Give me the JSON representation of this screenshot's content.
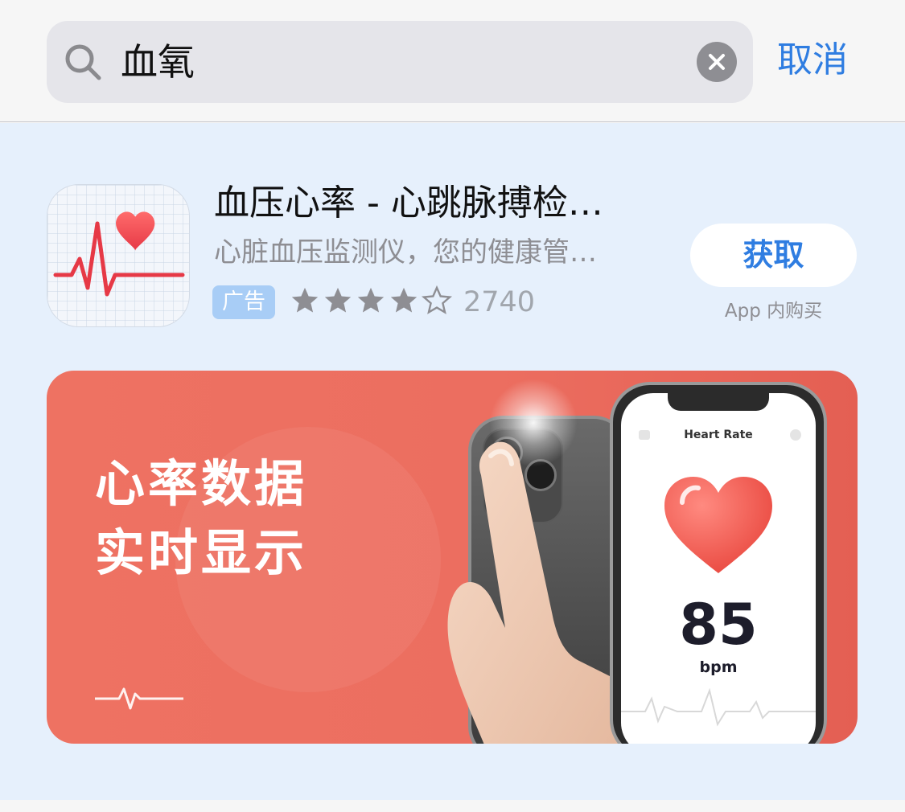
{
  "search": {
    "query": "血氧",
    "cancel_label": "取消"
  },
  "result": {
    "title": "血压心率 - 心跳脉搏检…",
    "subtitle": "心脏血压监测仪，您的健康管…",
    "ad_badge": "广告",
    "rating": 4,
    "rating_max": 5,
    "rating_count": "2740",
    "get_label": "获取",
    "in_app_note": "App 内购买"
  },
  "banner": {
    "line1": "心率数据",
    "line2": "实时显示",
    "screen_title": "Heart Rate",
    "bpm_value": "85",
    "bpm_unit": "bpm"
  },
  "colors": {
    "accent": "#2f7de1",
    "banner": "#ec6e60",
    "ad_badge": "#a8cdf6",
    "result_bg": "#e6f0fc"
  },
  "icons": {
    "search": "search-icon",
    "clear": "clear-icon",
    "app": "heart-ecg-icon",
    "star_full": "star-icon",
    "star_empty": "star-outline-icon"
  }
}
